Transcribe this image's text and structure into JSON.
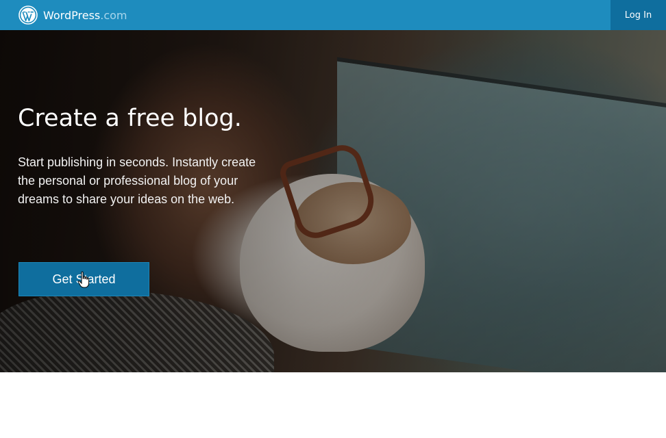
{
  "masterbar": {
    "brand_name": "WordPress",
    "brand_domain": ".com",
    "login_label": "Log In",
    "color": "#1e8cbe"
  },
  "hero": {
    "headline": "Create a free blog.",
    "subtext": "Start publishing in seconds. Instantly create the personal or professional blog of your dreams to share your ideas on the web.",
    "cta_label": "Get Started",
    "cta_color": "#0f6e9e"
  },
  "icons": {
    "logo": "wordpress-logo-icon",
    "cursor": "hand-pointer-icon"
  }
}
